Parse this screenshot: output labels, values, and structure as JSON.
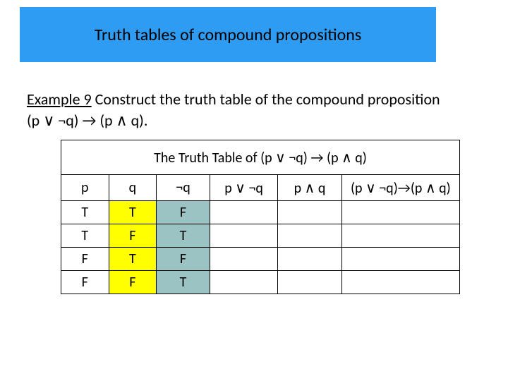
{
  "title": "Truth tables of compound propositions",
  "example": {
    "label": "Example 9",
    "text": " Construct the truth table of the compound proposition (p ∨ ¬q) → (p ∧ q)."
  },
  "table": {
    "caption": "The Truth Table of (p ∨ ¬q) → (p ∧ q)",
    "headers": {
      "p": "p",
      "q": "q",
      "notq": "¬q",
      "p_or_notq": "p ∨ ¬q",
      "p_and_q": "p ∧ q",
      "result": "(p ∨ ¬q)→(p ∧ q)"
    },
    "rows": [
      {
        "p": "T",
        "q": "T",
        "notq": "F",
        "p_or_notq": "",
        "p_and_q": "",
        "result": ""
      },
      {
        "p": "T",
        "q": "F",
        "notq": "T",
        "p_or_notq": "",
        "p_and_q": "",
        "result": ""
      },
      {
        "p": "F",
        "q": "T",
        "notq": "F",
        "p_or_notq": "",
        "p_and_q": "",
        "result": ""
      },
      {
        "p": "F",
        "q": "F",
        "notq": "T",
        "p_or_notq": "",
        "p_and_q": "",
        "result": ""
      }
    ]
  }
}
